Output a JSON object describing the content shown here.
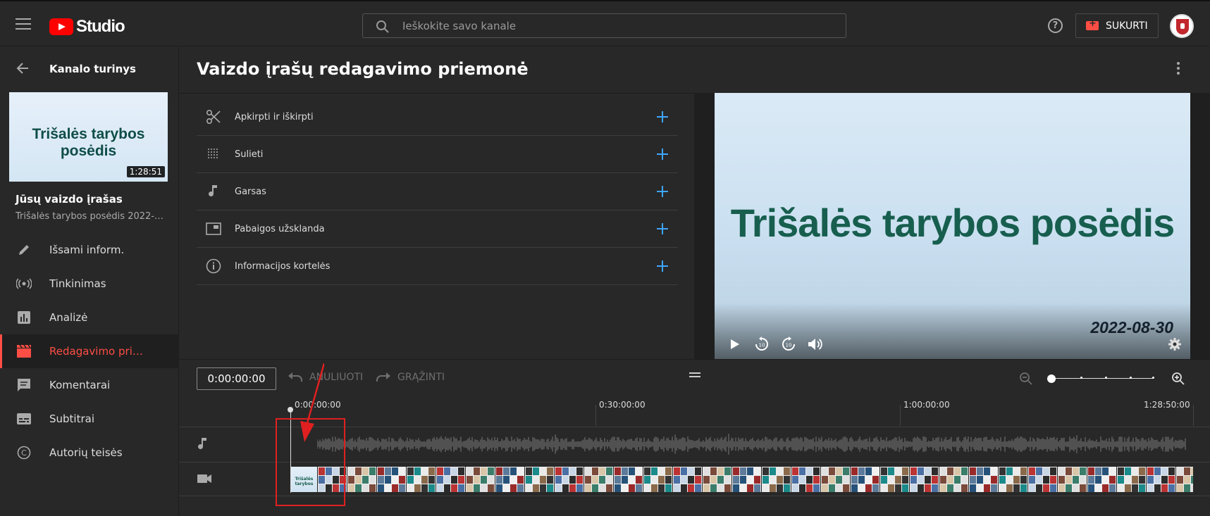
{
  "header": {
    "logo_text": "Studio",
    "search_placeholder": "Ieškokite savo kanale",
    "help_label": "?",
    "create_label": "SUKURTI"
  },
  "sidebar": {
    "channel_title": "Kanalo turinys",
    "thumbnail_title": "Trišalės tarybos posėdis",
    "thumbnail_duration": "1:28:51",
    "your_video_label": "Jūsų vaizdo įrašas",
    "video_subtitle": "Trišalės tarybos posėdis 2022-0...",
    "items": [
      {
        "label": "Išsami inform.",
        "icon": "pencil-icon",
        "active": false
      },
      {
        "label": "Tinkinimas",
        "icon": "broadcast-icon",
        "active": false
      },
      {
        "label": "Analizė",
        "icon": "analytics-icon",
        "active": false
      },
      {
        "label": "Redagavimo prie...",
        "icon": "clapperboard-icon",
        "active": true
      },
      {
        "label": "Komentarai",
        "icon": "comment-icon",
        "active": false
      },
      {
        "label": "Subtitrai",
        "icon": "subtitles-icon",
        "active": false
      },
      {
        "label": "Autorių teisės",
        "icon": "copyright-icon",
        "active": false
      }
    ]
  },
  "main": {
    "title": "Vaizdo įrašų redagavimo priemonė",
    "tools": [
      {
        "label": "Apkirpti ir iškirpti",
        "icon": "scissors-icon"
      },
      {
        "label": "Sulieti",
        "icon": "blur-icon"
      },
      {
        "label": "Garsas",
        "icon": "music-note-icon"
      },
      {
        "label": "Pabaigos užsklanda",
        "icon": "end-screen-icon"
      },
      {
        "label": "Informacijos kortelės",
        "icon": "info-icon"
      }
    ]
  },
  "preview": {
    "title": "Trišalės tarybos posėdis",
    "date": "2022-08-30"
  },
  "timeline": {
    "current_time": "0:00:00:00",
    "undo_label": "ANULIUOTI",
    "redo_label": "GRĄŽINTI",
    "ticks": [
      "0:00:00:00",
      "0:30:00:00",
      "1:00:00:00",
      "1:28:50:00"
    ],
    "video_thumb_label": "Trišalės tarybos",
    "accent_color": "#ff4e45",
    "link_color": "#3ea6ff",
    "annotation_color": "#e02020"
  }
}
